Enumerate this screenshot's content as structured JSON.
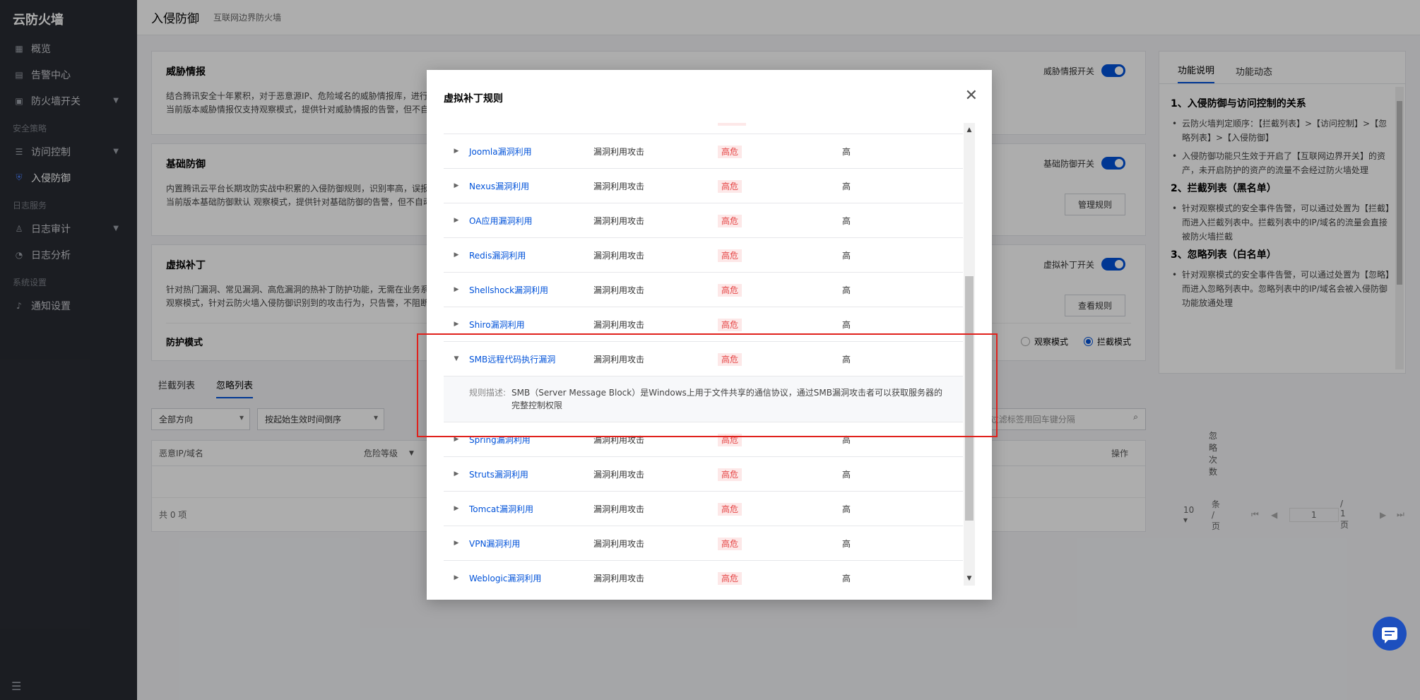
{
  "sidebar": {
    "brand": "云防火墙",
    "items": [
      {
        "label": "概览",
        "icon": "grid-icon"
      },
      {
        "label": "告警中心",
        "icon": "alert-icon"
      },
      {
        "label": "防火墙开关",
        "icon": "switch-icon",
        "expandable": true
      }
    ],
    "section_policy": "安全策略",
    "policy_items": [
      {
        "label": "访问控制",
        "icon": "sliders-icon",
        "expandable": true
      },
      {
        "label": "入侵防御",
        "icon": "shield-icon",
        "active": true
      }
    ],
    "section_logs": "日志服务",
    "log_items": [
      {
        "label": "日志审计",
        "icon": "user-log-icon",
        "expandable": true
      },
      {
        "label": "日志分析",
        "icon": "analytics-icon"
      }
    ],
    "section_system": "系统设置",
    "system_items": [
      {
        "label": "通知设置",
        "icon": "bell-icon"
      }
    ]
  },
  "header": {
    "title": "入侵防御",
    "subtitle": "互联网边界防火墙"
  },
  "cards": {
    "threat": {
      "title": "威胁情报",
      "desc_line1": "结合腾讯安全十年累积，对于恶意源IP、危险域名的威胁情报库，进行",
      "desc_line2": "当前版本威胁情报仅支持观察模式，提供针对威胁情报的告警，但不自",
      "switch_label": "威胁情报开关"
    },
    "basic": {
      "title": "基础防御",
      "desc_line1": "内置腾讯云平台长期攻防实战中积累的入侵防御规则，识别率高，误报",
      "desc_line2": "当前版本基础防御默认 观察模式，提供针对基础防御的告警，但不自动",
      "switch_label": "基础防御开关",
      "button": "管理规则"
    },
    "patch": {
      "title": "虚拟补丁",
      "desc_line1": "针对热门漏洞、常见漏洞、高危漏洞的热补丁防护功能，无需在业务系",
      "desc_line2": "观察模式，针对云防火墙入侵防御识别到的攻击行为，只告警，不阻断连",
      "switch_label": "虚拟补丁开关",
      "button": "查看规则",
      "mode_label": "防护模式",
      "mode_observe": "观察模式",
      "mode_block": "拦截模式"
    }
  },
  "lists": {
    "tab_block": "拦截列表",
    "tab_ignore": "忽略列表",
    "filter_direction": "全部方向",
    "filter_sort": "按起始生效时间倒序",
    "search_placeholder": "多个关键字用竖线 \"|\" 分隔，多个过滤标签用回车键分隔",
    "col_ip": "恶意IP/域名",
    "col_level": "危险等级",
    "col_count": "忽略次数",
    "col_action": "操作",
    "total": "共 0 项",
    "page_size": "10",
    "per_page": "条 / 页",
    "page_current": "1",
    "page_total": "/ 1 页"
  },
  "help": {
    "tab_desc": "功能说明",
    "tab_news": "功能动态",
    "s1_title": "1、入侵防御与访问控制的关系",
    "s1_item1": "云防火墙判定顺序：【拦截列表】>【访问控制】>【忽略列表】>【入侵防御】",
    "s1_item2": "入侵防御功能只生效于开启了【互联网边界开关】的资产，未开启防护的资产的流量不会经过防火墙处理",
    "s2_title": "2、拦截列表（黑名单）",
    "s2_item1": "针对观察模式的安全事件告警，可以通过处置为【拦截】而进入拦截列表中。拦截列表中的IP/域名的流量会直接被防火墙拦截",
    "s3_title": "3、忽略列表（白名单）",
    "s3_item1": "针对观察模式的安全事件告警，可以通过处置为【忽略】而进入忽略列表中。忽略列表中的IP/域名会被入侵防御功能放通处理"
  },
  "modal": {
    "title": "虚拟补丁规则",
    "rules": [
      {
        "name": "Joomla漏洞利用",
        "category": "漏洞利用攻击",
        "level": "高危",
        "severity": "高"
      },
      {
        "name": "Nexus漏洞利用",
        "category": "漏洞利用攻击",
        "level": "高危",
        "severity": "高"
      },
      {
        "name": "OA应用漏洞利用",
        "category": "漏洞利用攻击",
        "level": "高危",
        "severity": "高"
      },
      {
        "name": "Redis漏洞利用",
        "category": "漏洞利用攻击",
        "level": "高危",
        "severity": "高"
      },
      {
        "name": "Shellshock漏洞利用",
        "category": "漏洞利用攻击",
        "level": "高危",
        "severity": "高"
      },
      {
        "name": "Shiro漏洞利用",
        "category": "漏洞利用攻击",
        "level": "高危",
        "severity": "高"
      },
      {
        "name": "SMB远程代码执行漏洞",
        "category": "漏洞利用攻击",
        "level": "高危",
        "severity": "高",
        "expanded": true
      },
      {
        "name": "Spring漏洞利用",
        "category": "漏洞利用攻击",
        "level": "高危",
        "severity": "高"
      },
      {
        "name": "Struts漏洞利用",
        "category": "漏洞利用攻击",
        "level": "高危",
        "severity": "高"
      },
      {
        "name": "Tomcat漏洞利用",
        "category": "漏洞利用攻击",
        "level": "高危",
        "severity": "高"
      },
      {
        "name": "VPN漏洞利用",
        "category": "漏洞利用攻击",
        "level": "高危",
        "severity": "高"
      },
      {
        "name": "Weblogic漏洞利用",
        "category": "漏洞利用攻击",
        "level": "高危",
        "severity": "高"
      }
    ],
    "desc_label": "规则描述:",
    "desc_text": "SMB（Server Message Block）是Windows上用于文件共享的通信协议，通过SMB漏洞攻击者可以获取服务器的完整控制权限"
  },
  "colors": {
    "accent": "#0052d9",
    "danger": "#e54545",
    "highlight_box": "#e0211c"
  }
}
